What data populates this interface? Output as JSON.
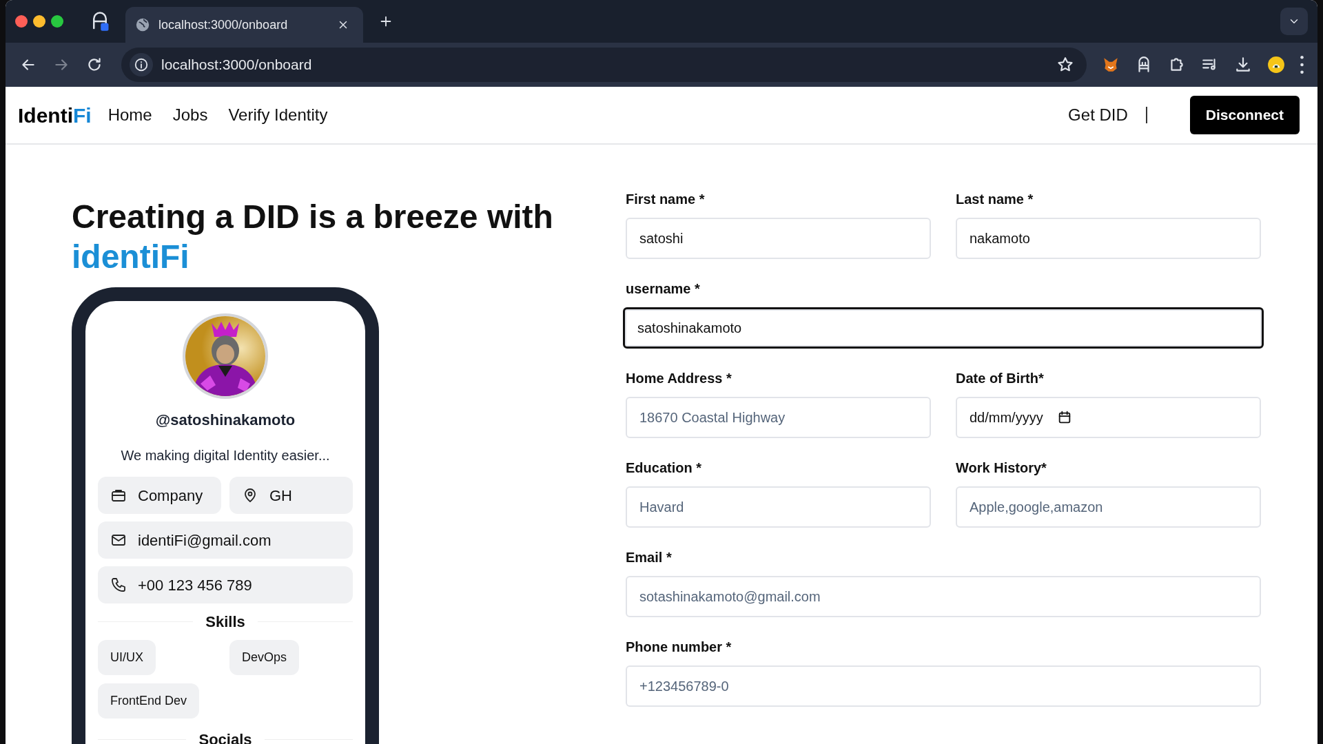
{
  "browser": {
    "tabs": [
      {
        "title": "localhost:3000/onboard",
        "selected": true
      }
    ],
    "address": "localhost:3000/onboard",
    "forward_disabled": true
  },
  "navbar": {
    "brand": [
      "Identi",
      "Fi"
    ],
    "links": [
      "Home",
      "Jobs",
      "Verify Identity"
    ],
    "get_did": "Get DID",
    "disconnect": "Disconnect"
  },
  "hero": {
    "title": "Creating a DID is a breeze with",
    "accent": "identiFi"
  },
  "profile": {
    "avatar": {
      "kind": "picture"
    },
    "handle": "@satoshinakamoto",
    "bio": "We making digital Identity easier...",
    "chips": [
      {
        "kind": "company",
        "text": "Company",
        "wide": false
      },
      {
        "kind": "location",
        "text": "GH",
        "wide": false
      },
      {
        "kind": "email",
        "text": "identiFi@gmail.com",
        "wide": true
      },
      {
        "kind": "phone",
        "text": "+00 123 456 789",
        "wide": true
      }
    ],
    "skills_title": "Skills",
    "skills": [
      "UI/UX",
      "DevOps",
      "FrontEnd Dev"
    ],
    "socials_title": "Socials"
  },
  "form": {
    "fields": [
      {
        "label": "First name *",
        "kind": "text",
        "value": "satoshi",
        "wide": false,
        "focused": false
      },
      {
        "label": "Last name *",
        "kind": "text",
        "value": "nakamoto",
        "wide": false,
        "focused": false
      },
      {
        "label": "username *",
        "kind": "text",
        "value": "satoshinakamoto",
        "wide": true,
        "focused": true
      },
      {
        "label": "Home Address *",
        "kind": "text",
        "placeholder": "18670 Coastal Highway",
        "wide": false,
        "focused": false
      },
      {
        "label": "Date of Birth*",
        "kind": "date",
        "value": "dd/mm/yyyy",
        "wide": false,
        "focused": false
      },
      {
        "label": "Education *",
        "kind": "text",
        "placeholder": "Havard",
        "wide": false,
        "focused": false
      },
      {
        "label": "Work History*",
        "kind": "text",
        "placeholder": "Apple,google,amazon",
        "wide": false,
        "focused": false
      },
      {
        "label": "Email *",
        "kind": "text",
        "placeholder": "sotashinakamoto@gmail.com",
        "wide": true,
        "focused": false
      },
      {
        "label": "Phone number *",
        "kind": "text",
        "placeholder": "+123456789-0",
        "wide": true,
        "focused": false
      }
    ]
  }
}
